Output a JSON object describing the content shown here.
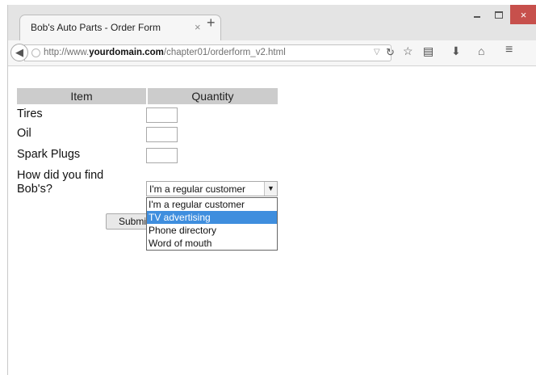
{
  "browser": {
    "tab_title": "Bob's Auto Parts - Order Form",
    "tab_close": "×",
    "new_tab": "+",
    "url_prefix": "http://www.",
    "url_domain": "yourdomain.com",
    "url_path": "/chapter01/orderform_v2.html",
    "window_controls": {
      "close": "×"
    }
  },
  "icons": [
    "back-arrow-icon",
    "globe-icon",
    "url-dropdown-icon",
    "reload-icon",
    "bookmark-star-icon",
    "reading-list-icon",
    "download-arrow-icon",
    "home-icon",
    "menu-icon"
  ],
  "colors": {
    "header_bg": "#cccccc",
    "selected_option": "#3f8ede",
    "close_button": "#c7504c"
  },
  "form": {
    "headers": {
      "item": "Item",
      "quantity": "Quantity"
    },
    "rows": [
      {
        "label": "Tires",
        "value": ""
      },
      {
        "label": "Oil",
        "value": ""
      },
      {
        "label": "Spark Plugs",
        "value": ""
      }
    ],
    "find_label_line1": "How did you find",
    "find_label_line2": "Bob's?",
    "find_selected": "I'm a regular customer",
    "find_options": [
      "I'm a regular customer",
      "TV advertising",
      "Phone directory",
      "Word of mouth"
    ],
    "find_highlighted": "TV advertising",
    "submit_label": "Submit Order"
  }
}
